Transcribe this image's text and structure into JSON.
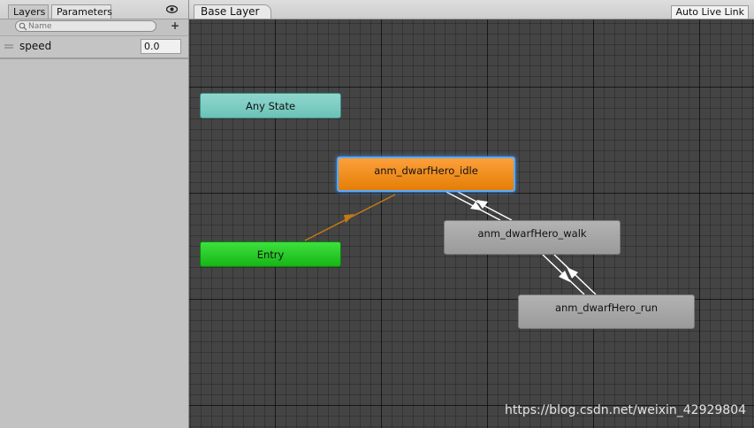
{
  "left_panel": {
    "tabs": [
      {
        "label": "Layers"
      },
      {
        "label": "Parameters"
      }
    ],
    "search": {
      "placeholder": "Name"
    },
    "parameters": [
      {
        "name": "speed",
        "value": "0.0"
      }
    ]
  },
  "graph": {
    "breadcrumb": "Base Layer",
    "auto_live_link_label": "Auto Live Link",
    "states": {
      "any_state": "Any State",
      "entry": "Entry",
      "idle": "anm_dwarfHero_idle",
      "walk": "anm_dwarfHero_walk",
      "run": "anm_dwarfHero_run"
    },
    "transitions": [
      {
        "from": "Entry",
        "to": "anm_dwarfHero_idle",
        "type": "default"
      },
      {
        "from": "anm_dwarfHero_idle",
        "to": "anm_dwarfHero_walk"
      },
      {
        "from": "anm_dwarfHero_walk",
        "to": "anm_dwarfHero_idle"
      },
      {
        "from": "anm_dwarfHero_walk",
        "to": "anm_dwarfHero_run"
      },
      {
        "from": "anm_dwarfHero_run",
        "to": "anm_dwarfHero_walk"
      }
    ]
  },
  "watermark": "https://blog.csdn.net/weixin_42929804",
  "colors": {
    "any_state": "#7ccdc3",
    "entry": "#27c927",
    "idle_default": "#f28f1f",
    "selection": "#59a9ff",
    "state_gray": "#a6a6a6",
    "graph_bg": "#444444",
    "transition": "#ffffff",
    "default_transition": "#c07a16"
  },
  "icons": [
    "eye-icon",
    "search-icon",
    "add-icon",
    "drag-handle-icon",
    "arrow-icon"
  ]
}
